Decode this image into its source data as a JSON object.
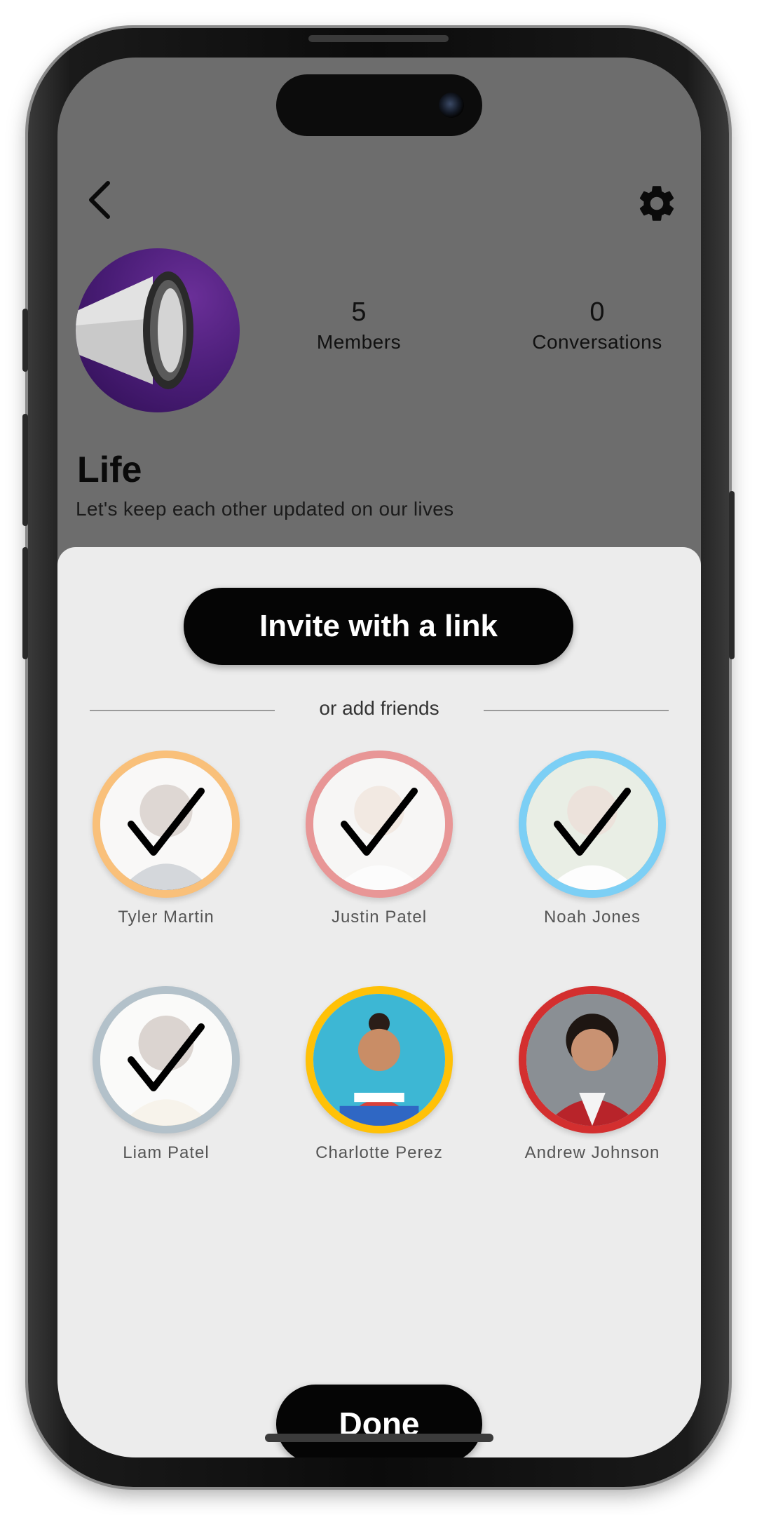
{
  "colors": {
    "sheet_bg": "#ececec",
    "screen_bg": "#6d6d6d",
    "button_bg": "#050505",
    "button_text": "#ffffff"
  },
  "header": {
    "back_icon": "chevron-left-icon",
    "settings_icon": "gear-icon"
  },
  "group": {
    "avatar_icon": "megaphone-icon",
    "name": "Life",
    "description": "Let's keep each other updated on our lives",
    "stats": [
      {
        "value": "5",
        "label": "Members"
      },
      {
        "value": "0",
        "label": "Conversations"
      }
    ]
  },
  "sheet": {
    "invite_label": "Invite with a link",
    "divider_text": "or add friends",
    "done_label": "Done",
    "friends": [
      {
        "name": "Tyler Martin",
        "ring": "#f9c07a",
        "selected": true
      },
      {
        "name": "Justin Patel",
        "ring": "#e89696",
        "selected": true
      },
      {
        "name": "Noah Jones",
        "ring": "#7ccff5",
        "selected": true
      },
      {
        "name": "Liam Patel",
        "ring": "#b3c1ca",
        "selected": true
      },
      {
        "name": "Charlotte Perez",
        "ring": "#ffc107",
        "selected": false
      },
      {
        "name": "Andrew Johnson",
        "ring": "#d32f2f",
        "selected": false
      },
      {
        "name": "",
        "ring": "#a64bc8",
        "selected": false
      },
      {
        "name": "",
        "ring": "#3f51b5",
        "selected": false
      },
      {
        "name": "",
        "ring": "#673ab7",
        "selected": false
      }
    ]
  }
}
